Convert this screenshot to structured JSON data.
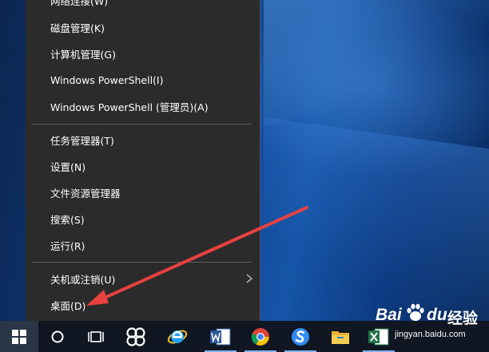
{
  "menu": {
    "items": [
      {
        "label": "网络连接(W)"
      },
      {
        "label": "磁盘管理(K)"
      },
      {
        "label": "计算机管理(G)"
      },
      {
        "label": "Windows PowerShell(I)"
      },
      {
        "label": "Windows PowerShell (管理员)(A)"
      },
      {
        "label": "任务管理器(T)"
      },
      {
        "label": "设置(N)"
      },
      {
        "label": "文件资源管理器"
      },
      {
        "label": "搜索(S)"
      },
      {
        "label": "运行(R)"
      },
      {
        "label": "关机或注销(U)"
      },
      {
        "label": "桌面(D)"
      }
    ]
  },
  "taskbar": {
    "icons": [
      "windows-start-icon",
      "search-circle-icon",
      "task-view-icon",
      "app-icon",
      "internet-explorer-icon",
      "word-icon",
      "chrome-icon",
      "sogou-icon",
      "file-explorer-icon",
      "excel-icon"
    ]
  },
  "annotation": {
    "arrow_color": "#e8413f"
  },
  "watermark": {
    "brand_bai": "Bai",
    "brand_du": "du",
    "suffix": "经验",
    "url": "jingyan.baidu.com"
  },
  "colors": {
    "menu_bg": "#2b2b2b",
    "taskbar_bg": "#101622",
    "accent": "#0078d7"
  }
}
